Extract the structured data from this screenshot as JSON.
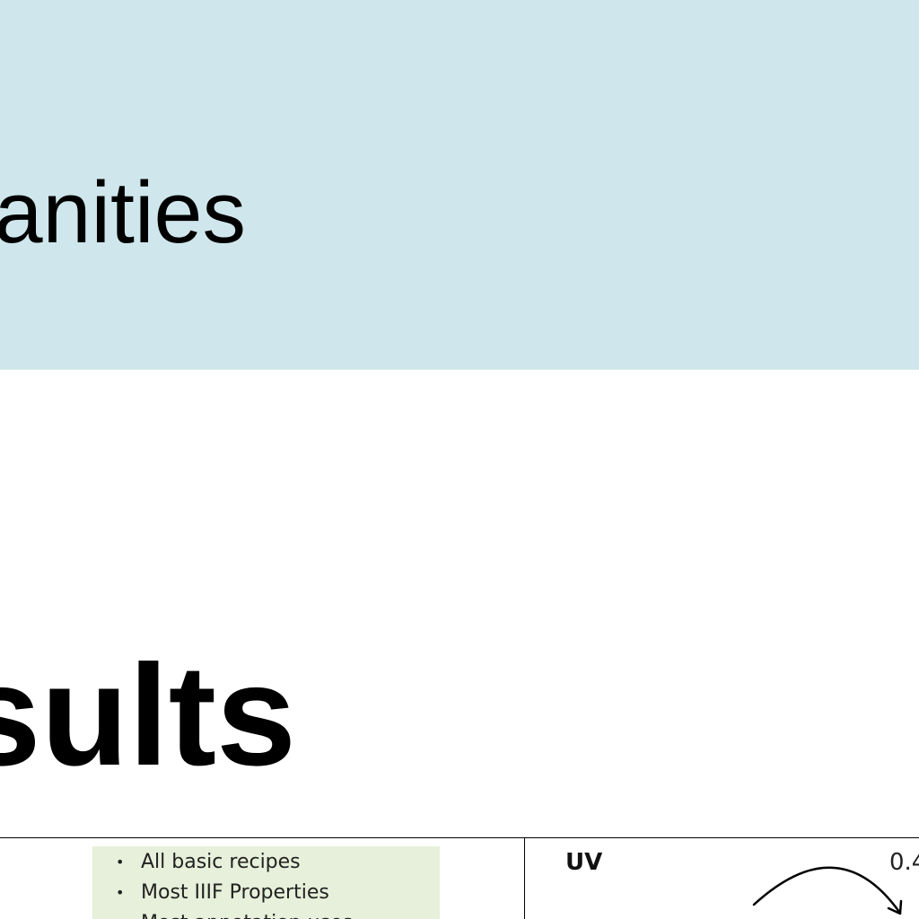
{
  "banner": {
    "text": "anities",
    "background_color": "#cfe7ec"
  },
  "section": {
    "heading": "sults"
  },
  "features": {
    "background_color": "#e6f0da",
    "items": [
      "All basic recipes",
      "Most IIIF Properties",
      "Most annotation uses"
    ]
  },
  "uv": {
    "label": "UV",
    "value": "0.4"
  },
  "icons": {
    "arc": "curved-arrow-icon"
  }
}
